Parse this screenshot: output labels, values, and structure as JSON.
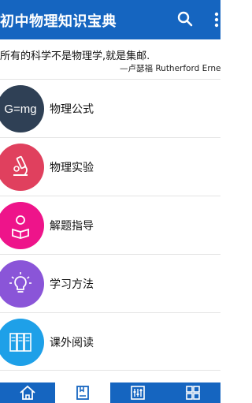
{
  "appbar": {
    "title": "初中物理知识宝典",
    "icons": [
      "search-icon",
      "more-vertical-icon"
    ]
  },
  "quote": {
    "text": "所有的科学不是物理学,就是集邮.",
    "author": "—卢瑟福 Rutherford Ernest"
  },
  "menu": {
    "items": [
      {
        "label": "物理公式",
        "icon_text": "G=mg",
        "color": "#2f4055"
      },
      {
        "label": "物理实验",
        "icon": "microscope-icon",
        "color": "#e0405e"
      },
      {
        "label": "解题指导",
        "icon": "reading-person-icon",
        "color": "#ee148a"
      },
      {
        "label": "学习方法",
        "icon": "lightbulb-icon",
        "color": "#8a55d8"
      },
      {
        "label": "课外阅读",
        "icon": "bookshelf-icon",
        "color": "#1ea0e8"
      }
    ]
  },
  "bottom_nav": {
    "tabs": [
      "home-icon",
      "book-icon",
      "sliders-icon",
      "grid-icon"
    ],
    "active_index": 1
  },
  "colors": {
    "primary": "#1565c0",
    "background": "#ffffff"
  }
}
